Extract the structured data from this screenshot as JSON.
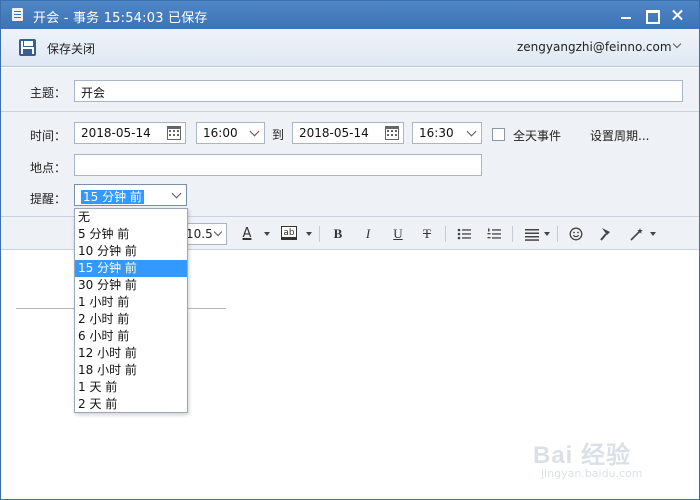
{
  "window": {
    "title": "开会 - 事务   15:54:03 已保存"
  },
  "toolbar": {
    "save_close_label": "保存关闭",
    "account": "zengyangzhi@feinno.com"
  },
  "form": {
    "subject_label": "主题：",
    "subject_value": "开会",
    "time_label": "时间：",
    "start_date": "2018-05-14",
    "start_time": "16:00",
    "to_label": "到",
    "end_date": "2018-05-14",
    "end_time": "16:30",
    "all_day_label": "全天事件",
    "all_day_checked": false,
    "recurrence_label": "设置周期...",
    "location_label": "地点：",
    "location_value": "",
    "reminder_label": "提醒：",
    "reminder_value": "15 分钟 前"
  },
  "format_toolbar": {
    "font_size": "10.5",
    "bold": "B",
    "italic": "I",
    "underline": "U",
    "strike": "T",
    "font_color_glyph": "A",
    "highlight_glyph": "ab"
  },
  "reminder_options": [
    "无",
    "5 分钟 前",
    "10 分钟 前",
    "15 分钟 前",
    "30 分钟 前",
    "1 小时 前",
    "2 小时 前",
    "6 小时 前",
    "12 小时 前",
    "18 小时 前",
    "1 天 前",
    "2 天 前"
  ],
  "reminder_selected_index": 3,
  "colors": {
    "titlebar": "#3d73b6",
    "selection": "#3399ff"
  },
  "watermark": {
    "text": "Bai 经验",
    "sub": "jingyan.baidu.com"
  }
}
